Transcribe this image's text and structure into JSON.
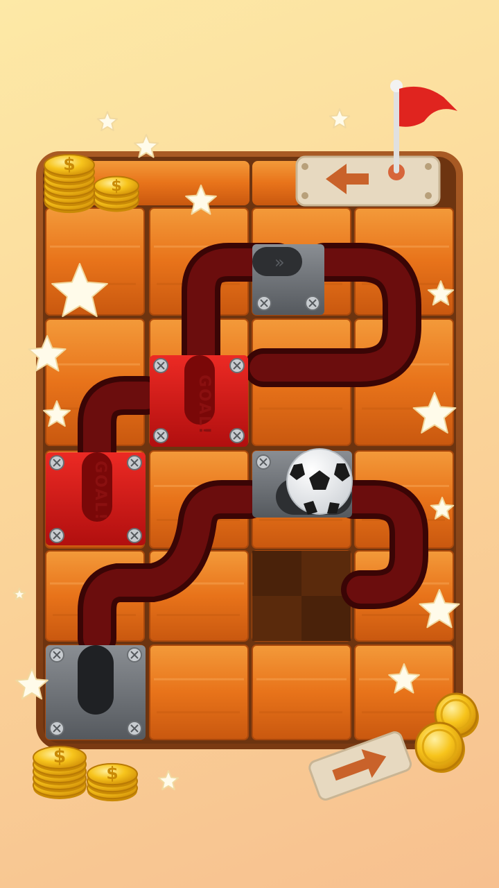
{
  "game": {
    "board_label": "GOAL!",
    "goal_tiles": [
      {
        "id": "goal-tile-a",
        "label": "GOAL!"
      },
      {
        "id": "goal-tile-b",
        "label": "GOAL!"
      }
    ],
    "colors": {
      "wood": "#e8731a",
      "wood_dark": "#b8520e",
      "frame": "#8b4513",
      "pipe": "#5c0a0a",
      "goal": "#d11a1a",
      "metal": "#6b6f74",
      "flag": "#e0241f",
      "coin": "#f4c21b"
    }
  },
  "icons": [
    "flag-icon",
    "arrow-left-icon",
    "arrow-right-icon",
    "coin-icon",
    "star-icon",
    "screw-icon",
    "soccer-ball-icon"
  ]
}
